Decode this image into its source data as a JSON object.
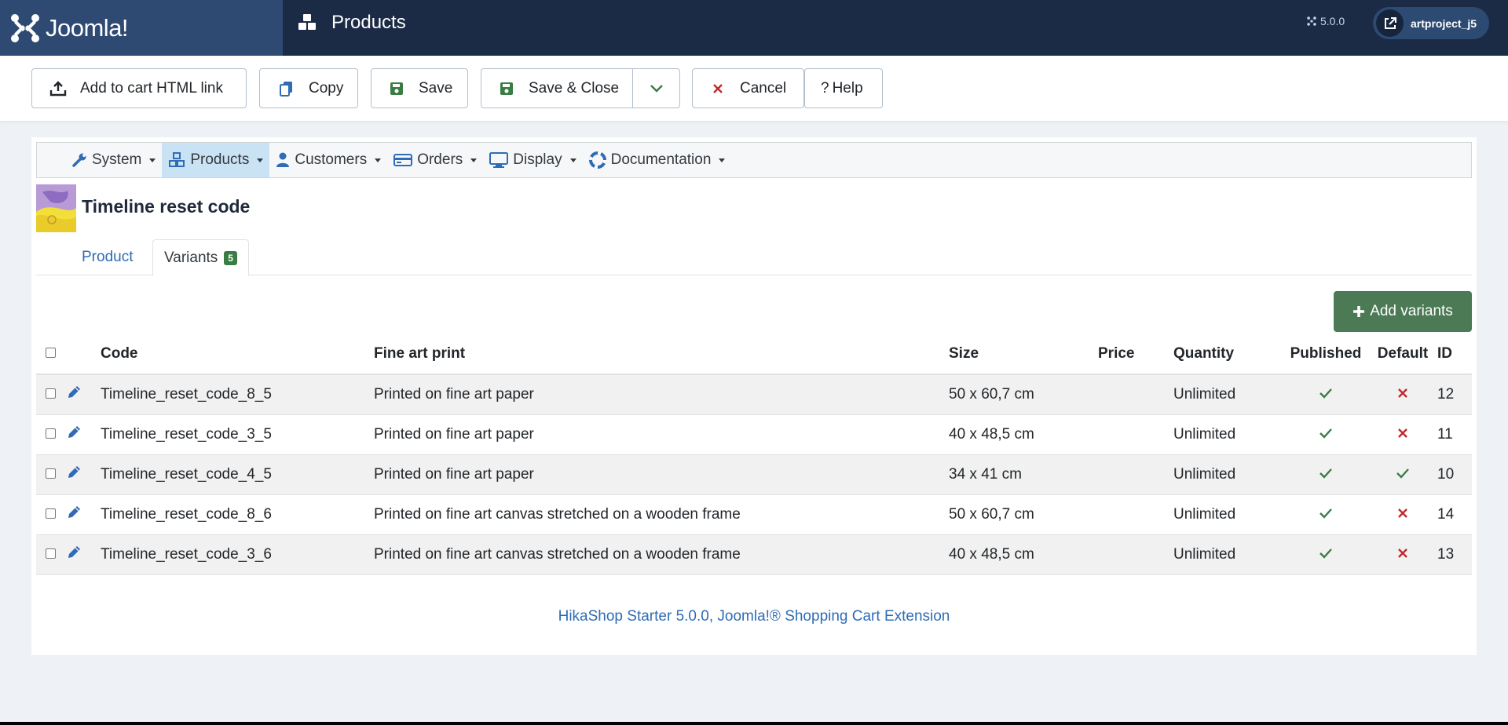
{
  "header": {
    "brand": "Joomla!",
    "page_title": "Products",
    "version": "5.0.0",
    "user": "artproject_j5"
  },
  "toolbar": {
    "add_to_cart": "Add to cart HTML link",
    "copy": "Copy",
    "save": "Save",
    "save_close": "Save & Close",
    "cancel": "Cancel",
    "help": "Help"
  },
  "submenu": {
    "system": "System",
    "products": "Products",
    "customers": "Customers",
    "orders": "Orders",
    "display": "Display",
    "documentation": "Documentation"
  },
  "product": {
    "title": "Timeline reset code"
  },
  "tabs": {
    "product": "Product",
    "variants": "Variants",
    "variants_count": "5"
  },
  "add_variants": "Add variants",
  "table": {
    "headers": {
      "code": "Code",
      "fine_art": "Fine art print",
      "size": "Size",
      "price": "Price",
      "quantity": "Quantity",
      "published": "Published",
      "default": "Default",
      "id": "ID"
    },
    "rows": [
      {
        "code": "Timeline_reset_code_8_5",
        "fine_art": "Printed on fine art paper",
        "size": "50 x 60,7 cm",
        "price": "",
        "quantity": "Unlimited",
        "published": true,
        "default": false,
        "id": "12"
      },
      {
        "code": "Timeline_reset_code_3_5",
        "fine_art": "Printed on fine art paper",
        "size": "40 x 48,5 cm",
        "price": "",
        "quantity": "Unlimited",
        "published": true,
        "default": false,
        "id": "11"
      },
      {
        "code": "Timeline_reset_code_4_5",
        "fine_art": "Printed on fine art paper",
        "size": "34 x 41 cm",
        "price": "",
        "quantity": "Unlimited",
        "published": true,
        "default": true,
        "id": "10"
      },
      {
        "code": "Timeline_reset_code_8_6",
        "fine_art": "Printed on fine art canvas stretched on a wooden frame",
        "size": "50 x 60,7 cm",
        "price": "",
        "quantity": "Unlimited",
        "published": true,
        "default": false,
        "id": "14"
      },
      {
        "code": "Timeline_reset_code_3_6",
        "fine_art": "Printed on fine art canvas stretched on a wooden frame",
        "size": "40 x 48,5 cm",
        "price": "",
        "quantity": "Unlimited",
        "published": true,
        "default": false,
        "id": "13"
      }
    ]
  },
  "footer": "HikaShop Starter 5.0.0, Joomla!® Shopping Cart Extension",
  "colors": {
    "header_bg": "#1b2a45",
    "brand_bg": "#2e4a73",
    "link": "#2f6cb5",
    "success": "#3a7d44",
    "danger": "#c0282d"
  }
}
